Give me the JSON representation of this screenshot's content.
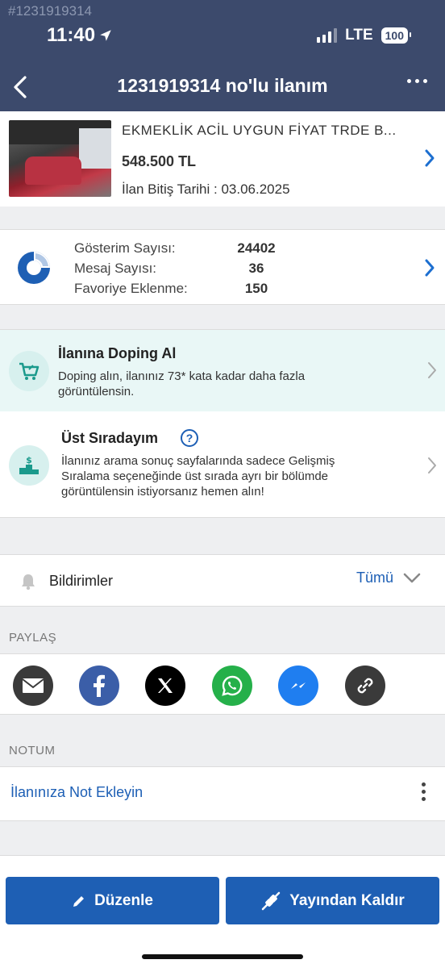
{
  "status_bar": {
    "watermark_id": "#1231919314",
    "time": "11:40",
    "network": "LTE",
    "battery": "100"
  },
  "header": {
    "title": "1231919314 no'lu ilanım"
  },
  "listing": {
    "title": "EKMEKLİK ACİL UYGUN FİYAT TRDE B...",
    "price": "548.500 TL",
    "end_date_label": "İlan Bitiş Tarihi : 03.06.2025"
  },
  "stats": {
    "rows": [
      {
        "label": "Gösterim Sayısı:",
        "value": "24402"
      },
      {
        "label": "Mesaj Sayısı:",
        "value": "36"
      },
      {
        "label": "Favoriye Eklenme:",
        "value": "150"
      }
    ]
  },
  "promos": {
    "doping": {
      "title": "İlanına Doping Al",
      "line1": "Doping alın, ilanınız 73* kata kadar daha fazla",
      "line2": "görüntülensin."
    },
    "top_rank": {
      "title": "Üst Sıradayım",
      "help": "?",
      "line1": "İlanınız arama sonuç sayfalarında sadece Gelişmiş",
      "line2": "Sıralama seçeneğinde üst sırada ayrı bir bölümde",
      "line3": "görüntülensin istiyorsanız hemen alın!"
    }
  },
  "notifications": {
    "label": "Bildirimler",
    "selected": "Tümü"
  },
  "share": {
    "label": "PAYLAŞ",
    "buttons": [
      {
        "name": "email",
        "color": "#3a3a3a"
      },
      {
        "name": "facebook",
        "color": "#3b5ea8"
      },
      {
        "name": "x",
        "color": "#000000"
      },
      {
        "name": "whatsapp",
        "color": "#25b04a"
      },
      {
        "name": "messenger",
        "color": "#1f7ef0"
      },
      {
        "name": "link",
        "color": "#3a3a3a"
      }
    ]
  },
  "note": {
    "section_label": "NOTUM",
    "link": "İlanınıza Not Ekleyin"
  },
  "actions": {
    "edit": "Düzenle",
    "unpublish": "Yayından Kaldır"
  },
  "colors": {
    "header_bg": "#3c4a6c",
    "accent": "#1e5fb4",
    "doping_bg": "#e9f7f6"
  }
}
